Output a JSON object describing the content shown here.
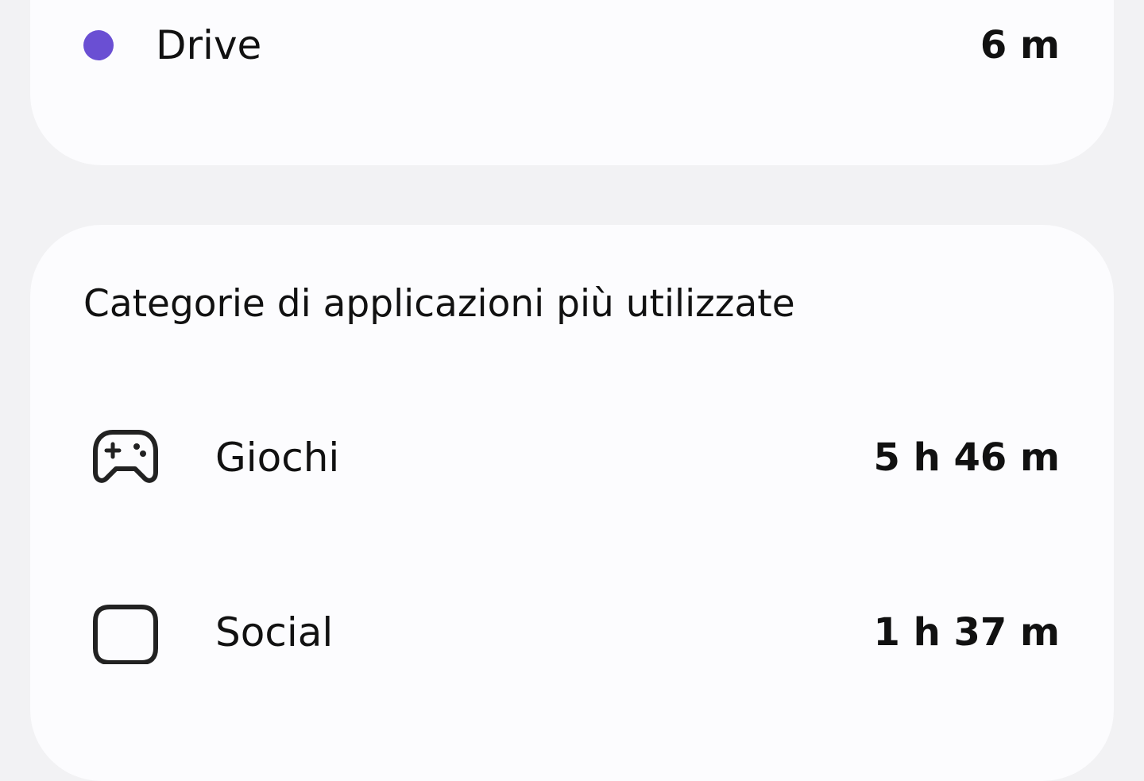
{
  "legend": {
    "items": [
      {
        "label": "Drive",
        "value": "6 m",
        "color": "#6a4fd3"
      }
    ]
  },
  "categories": {
    "title": "Categorie di applicazioni più utilizzate",
    "items": [
      {
        "icon": "gamepad-icon",
        "label": "Giochi",
        "value": "5 h 46 m"
      },
      {
        "icon": "chat-bubble-icon",
        "label": "Social",
        "value": "1 h 37 m"
      }
    ]
  }
}
